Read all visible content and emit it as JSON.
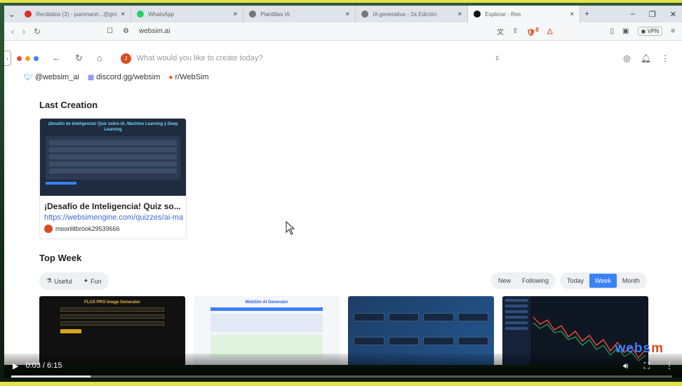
{
  "browser": {
    "tabs": [
      {
        "title": "Recibidos (3) - juanmanri...@gmail.com",
        "active": false
      },
      {
        "title": "WhatsApp",
        "active": false
      },
      {
        "title": "Plantillas IA",
        "active": false
      },
      {
        "title": "IA generativa - 2a Edición",
        "active": false
      },
      {
        "title": "Explorar - Res",
        "active": true
      }
    ],
    "new_tab": "+",
    "url": "websim.ai",
    "vpn_label": "VPN",
    "brave_badge": "8"
  },
  "websim": {
    "prompt_placeholder": "What would you like to create today?",
    "avatar_letter": "J",
    "social": [
      {
        "icon": "twitter-icon",
        "label": "@websim_ai"
      },
      {
        "icon": "discord-icon",
        "label": "discord.gg/websim"
      },
      {
        "icon": "reddit-icon",
        "label": "r/WebSim"
      }
    ],
    "last_creation_heading": "Last Creation",
    "last_creation": {
      "thumb_title": "¡Desafío de Inteligencia! Quiz sobre IA, Machine Learning y Deep Learning",
      "title": "¡Desafío de Inteligencia! Quiz so...",
      "link": "https://websimengine.com/quizzes/ai-ma",
      "author": "moonlitbrook29539666"
    },
    "top_week_heading": "Top Week",
    "categories": [
      {
        "icon": "flask-icon",
        "label": "Useful"
      },
      {
        "icon": "party-icon",
        "label": "Fun"
      }
    ],
    "feed_filters": [
      "New",
      "Following"
    ],
    "period_filters": [
      "Today",
      "Week",
      "Month"
    ],
    "active_period": "Week",
    "tiles": [
      {
        "heading": "FLUX PRO Image Generator"
      },
      {
        "heading": "WebSim AI Generator"
      },
      {
        "heading": ""
      },
      {
        "heading": ""
      }
    ],
    "watermark_a": "webs",
    "watermark_b": "m"
  },
  "video": {
    "time": "0:03 / 6:15",
    "progress": 0.008
  }
}
